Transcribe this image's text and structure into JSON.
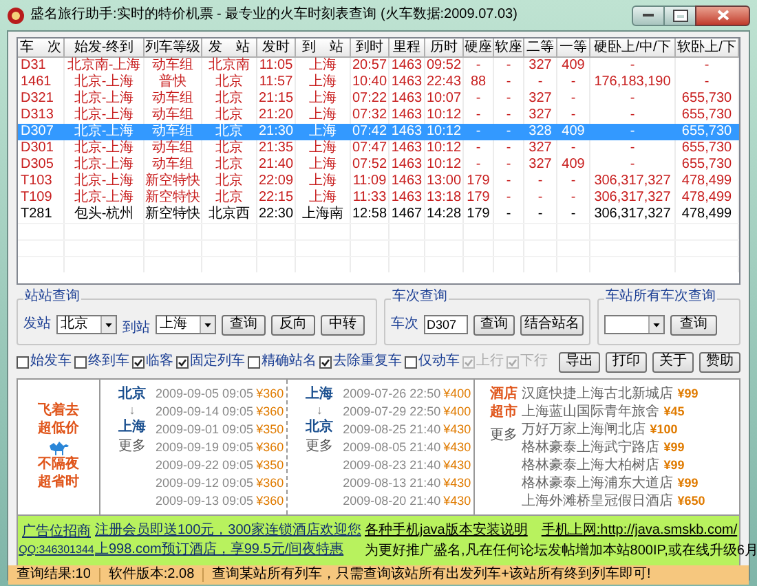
{
  "window": {
    "title": "盛名旅行助手:实时的特价机票 - 最专业的火车时刻表查询 (火车数据:2009.07.03)"
  },
  "table": {
    "columns": [
      "车　次",
      "始发-终到",
      "列车等级",
      "发　站",
      "发时",
      "到　站",
      "到时",
      "里程",
      "历时",
      "硬座",
      "软座",
      "二等",
      "一等",
      "硬卧上/中/下",
      "软卧上/下"
    ],
    "rows": [
      {
        "matched": true,
        "selected": false,
        "cells": [
          "D31",
          "北京南-上海",
          "动车组",
          "北京南",
          "11:05",
          "上海",
          "20:57",
          "1463",
          "09:52",
          "-",
          "-",
          "327",
          "409",
          "-",
          "-"
        ]
      },
      {
        "matched": true,
        "selected": false,
        "cells": [
          "1461",
          "北京-上海",
          "普快",
          "北京",
          "11:57",
          "上海",
          "10:40",
          "1463",
          "22:43",
          "88",
          "-",
          "-",
          "-",
          "176,183,190",
          "-"
        ]
      },
      {
        "matched": true,
        "selected": false,
        "cells": [
          "D321",
          "北京-上海",
          "动车组",
          "北京",
          "21:15",
          "上海",
          "07:22",
          "1463",
          "10:07",
          "-",
          "-",
          "327",
          "-",
          "-",
          "655,730"
        ]
      },
      {
        "matched": true,
        "selected": false,
        "cells": [
          "D313",
          "北京-上海",
          "动车组",
          "北京",
          "21:20",
          "上海",
          "07:32",
          "1463",
          "10:12",
          "-",
          "-",
          "327",
          "-",
          "-",
          "655,730"
        ]
      },
      {
        "matched": true,
        "selected": true,
        "cells": [
          "D307",
          "北京-上海",
          "动车组",
          "北京",
          "21:30",
          "上海",
          "07:42",
          "1463",
          "10:12",
          "-",
          "-",
          "328",
          "409",
          "-",
          "655,730"
        ]
      },
      {
        "matched": true,
        "selected": false,
        "cells": [
          "D301",
          "北京-上海",
          "动车组",
          "北京",
          "21:35",
          "上海",
          "07:47",
          "1463",
          "10:12",
          "-",
          "-",
          "327",
          "-",
          "-",
          "655,730"
        ]
      },
      {
        "matched": true,
        "selected": false,
        "cells": [
          "D305",
          "北京-上海",
          "动车组",
          "北京",
          "21:40",
          "上海",
          "07:52",
          "1463",
          "10:12",
          "-",
          "-",
          "327",
          "409",
          "-",
          "655,730"
        ]
      },
      {
        "matched": true,
        "selected": false,
        "cells": [
          "T103",
          "北京-上海",
          "新空特快",
          "北京",
          "22:09",
          "上海",
          "11:09",
          "1463",
          "13:00",
          "179",
          "-",
          "-",
          "-",
          "306,317,327",
          "478,499"
        ]
      },
      {
        "matched": true,
        "selected": false,
        "cells": [
          "T109",
          "北京-上海",
          "新空特快",
          "北京",
          "22:15",
          "上海",
          "11:33",
          "1463",
          "13:18",
          "179",
          "-",
          "-",
          "-",
          "306,317,327",
          "478,499"
        ]
      },
      {
        "matched": false,
        "selected": false,
        "cells": [
          "T281",
          "包头-杭州",
          "新空特快",
          "北京西",
          "22:30",
          "上海南",
          "12:58",
          "1467",
          "14:28",
          "179",
          "-",
          "-",
          "-",
          "306,317,327",
          "478,499"
        ]
      }
    ]
  },
  "station_query": {
    "title": "站站查询",
    "from_label": "发站",
    "from_value": "北京",
    "to_label": "到站",
    "to_value": "上海",
    "buttons": [
      "查询",
      "反向",
      "中转"
    ]
  },
  "train_query": {
    "title": "车次查询",
    "label": "车次",
    "value": "D307",
    "buttons": [
      "查询",
      "结合站名"
    ]
  },
  "station_all_query": {
    "title": "车站所有车次查询",
    "buttons": [
      "查询"
    ]
  },
  "filters": [
    {
      "label": "始发车",
      "checked": false,
      "disabled": false
    },
    {
      "label": "终到车",
      "checked": false,
      "disabled": false
    },
    {
      "label": "临客",
      "checked": true,
      "disabled": false
    },
    {
      "label": "固定列车",
      "checked": true,
      "disabled": false
    },
    {
      "label": "精确站名",
      "checked": false,
      "disabled": false
    },
    {
      "label": "去除重复车",
      "checked": true,
      "disabled": false
    },
    {
      "label": "仅动车",
      "checked": false,
      "disabled": false
    },
    {
      "label": "上行",
      "checked": true,
      "disabled": true
    },
    {
      "label": "下行",
      "checked": true,
      "disabled": true
    }
  ],
  "actions": [
    "导出",
    "打印",
    "关于",
    "赞助"
  ],
  "flight_ad": {
    "slogan_top": [
      "飞着去",
      "超低价"
    ],
    "slogan_bottom": [
      "不隔夜",
      "超省时"
    ],
    "routes": [
      {
        "from": "北京",
        "arrow": "↓",
        "to": "上海",
        "more": "更多",
        "fares": [
          {
            "date": "2009-09-05 09:05",
            "price": "¥360"
          },
          {
            "date": "2009-09-14 09:05",
            "price": "¥360"
          },
          {
            "date": "2009-09-01 09:05",
            "price": "¥350"
          },
          {
            "date": "2009-09-19 09:05",
            "price": "¥360"
          },
          {
            "date": "2009-09-22 09:05",
            "price": "¥350"
          },
          {
            "date": "2009-09-12 09:05",
            "price": "¥360"
          },
          {
            "date": "2009-09-13 09:05",
            "price": "¥360"
          }
        ]
      },
      {
        "from": "上海",
        "arrow": "↓",
        "to": "北京",
        "more": "更多",
        "fares": [
          {
            "date": "2009-07-26 22:50",
            "price": "¥400"
          },
          {
            "date": "2009-07-29 22:50",
            "price": "¥400"
          },
          {
            "date": "2009-08-25 21:40",
            "price": "¥430"
          },
          {
            "date": "2009-08-05 21:40",
            "price": "¥430"
          },
          {
            "date": "2009-08-23 21:40",
            "price": "¥430"
          },
          {
            "date": "2009-08-13 21:40",
            "price": "¥430"
          },
          {
            "date": "2009-08-20 21:40",
            "price": "¥430"
          }
        ]
      }
    ]
  },
  "hotel_ad": {
    "title": [
      "酒店",
      "超市"
    ],
    "more": "更多",
    "hotels": [
      {
        "name": "汉庭快捷上海古北新城店",
        "price": "¥99"
      },
      {
        "name": "上海蓝山国际青年旅舍",
        "price": "¥45"
      },
      {
        "name": "万好万家上海闸北店",
        "price": "¥100"
      },
      {
        "name": "格林豪泰上海武宁路店",
        "price": "¥99"
      },
      {
        "name": "格林豪泰上海大柏树店",
        "price": "¥99"
      },
      {
        "name": "格林豪泰上海浦东大道店",
        "price": "¥99"
      },
      {
        "name": "上海外滩桥皇冠假日酒店",
        "price": "¥650"
      }
    ]
  },
  "banner": {
    "ad_title": "广告位招商",
    "qq": "QQ:346301344",
    "promo_lines": [
      "注册会员即送100元，300家连锁酒店欢迎您",
      "上998.com预订酒店，享99.5元/间夜特惠"
    ],
    "java_link": "各种手机java版本安装说明",
    "mobile_link": "手机上网:http://java.smskb.com/",
    "notice": "为更好推广盛名,凡在任何论坛发帖增加本站800IP,或在线升级6月"
  },
  "status_bar": [
    "查询结果:10",
    "软件版本:2.08",
    "查询某站所有列车，只需查询该站所有出发列车+该站所有终到列车即可!"
  ]
}
